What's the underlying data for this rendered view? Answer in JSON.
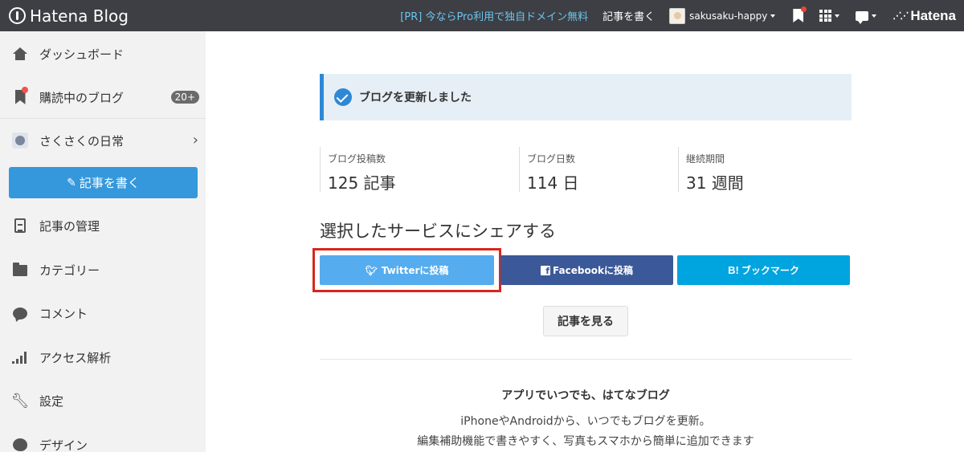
{
  "topbar": {
    "logo": "Hatena Blog",
    "promo": "[PR] 今ならPro利用で独自ドメイン無料",
    "write": "記事を書く",
    "username": "sakusaku-happy",
    "brand": "Hatena"
  },
  "sidebar": {
    "items": [
      {
        "label": "ダッシュボード",
        "icon": "home-icon"
      },
      {
        "label": "購読中のブログ",
        "icon": "bookmark-icon",
        "badge": "20+"
      },
      {
        "label": "さくさくの日常",
        "icon": "blog-avatar"
      },
      {
        "label": "記事の管理",
        "icon": "document-icon"
      },
      {
        "label": "カテゴリー",
        "icon": "folder-icon"
      },
      {
        "label": "コメント",
        "icon": "comment-icon"
      },
      {
        "label": "アクセス解析",
        "icon": "bar-chart-icon"
      },
      {
        "label": "設定",
        "icon": "wrench-icon"
      },
      {
        "label": "デザイン",
        "icon": "palette-icon"
      }
    ],
    "write_button": "記事を書く"
  },
  "notice": {
    "text": "ブログを更新しました"
  },
  "stats": [
    {
      "label": "ブログ投稿数",
      "value": "125 記事"
    },
    {
      "label": "ブログ日数",
      "value": "114 日"
    },
    {
      "label": "継続期間",
      "value": "31 週間"
    }
  ],
  "share": {
    "title": "選択したサービスにシェアする",
    "twitter": "Twitterに投稿",
    "facebook": "Facebookに投稿",
    "hatebu_mark": "B!",
    "hatebu": "ブックマーク"
  },
  "view_button": "記事を見る",
  "app": {
    "title": "アプリでいつでも、はてなブログ",
    "line1": "iPhoneやAndroidから、いつでもブログを更新。",
    "line2": "編集補助機能で書きやすく、写真もスマホから簡単に追加できます"
  },
  "colors": {
    "topbar": "#3d3f44",
    "accent": "#3598dc",
    "twitter": "#55acee",
    "facebook": "#3b5998",
    "hatebu": "#00a4de",
    "highlight": "#d9261c"
  }
}
